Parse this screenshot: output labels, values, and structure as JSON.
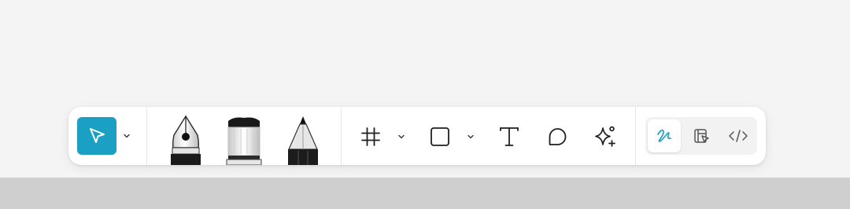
{
  "toolbar": {
    "tools": [
      {
        "id": "move",
        "icon": "cursor-arrow-icon",
        "selected": true,
        "has_dropdown": true
      },
      {
        "id": "pen",
        "icon": "fountain-pen-nib-icon"
      },
      {
        "id": "marker",
        "icon": "marker-brush-icon"
      },
      {
        "id": "pencil",
        "icon": "pencil-icon"
      },
      {
        "id": "frame",
        "icon": "frame-grid-icon",
        "has_dropdown": true
      },
      {
        "id": "shape",
        "icon": "square-icon",
        "has_dropdown": true
      },
      {
        "id": "text",
        "icon": "text-t-icon"
      },
      {
        "id": "comment",
        "icon": "comment-bubble-icon"
      },
      {
        "id": "actions",
        "icon": "sparkle-icon"
      }
    ],
    "modes": [
      {
        "id": "draw",
        "icon": "squiggle-draw-icon",
        "active": true
      },
      {
        "id": "design",
        "icon": "design-layout-icon",
        "active": false
      },
      {
        "id": "dev",
        "icon": "code-brackets-icon",
        "active": false
      }
    ],
    "colors": {
      "accent": "#1ba0c3",
      "background": "#f4f4f5",
      "toolbar": "#ffffff",
      "bottom_band": "#cfcfcf"
    }
  }
}
